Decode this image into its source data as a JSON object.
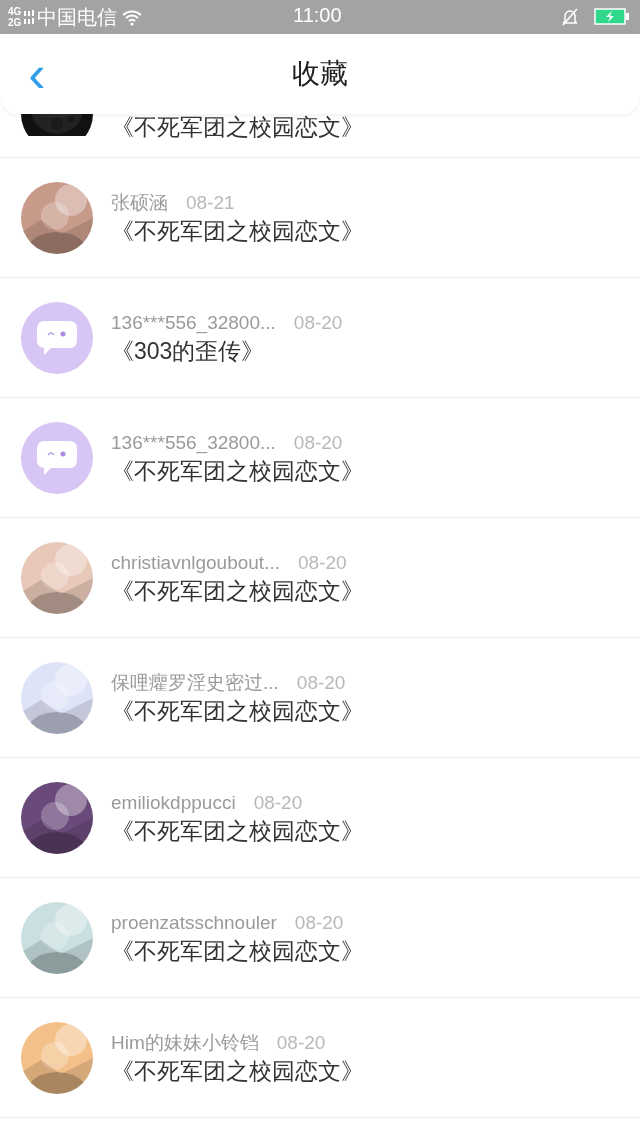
{
  "status_bar": {
    "network_top": "4G",
    "network_bottom": "2G",
    "carrier": "中国电信",
    "time": "11:00"
  },
  "header": {
    "back": "‹",
    "title": "收藏"
  },
  "items": [
    {
      "title": "《不死军团之校园恋文》"
    },
    {
      "name": "张硕涵",
      "date": "08-21",
      "title": "《不死军团之校园恋文》"
    },
    {
      "avatar": {
        "kind": "default",
        "color": "#d7c5f5"
      },
      "name": "136***556_32800...",
      "date": "08-20",
      "title": "《303的歪传》"
    },
    {
      "avatar": {
        "kind": "default",
        "color": "#d7c5f5"
      },
      "name": "136***556_32800...",
      "date": "08-20",
      "title": "《不死军团之校园恋文》"
    },
    {
      "name": "christiavnlgoubout...",
      "date": "08-20",
      "title": "《不死军团之校园恋文》"
    },
    {
      "name": "保哩癯罗淫史密过...",
      "date": "08-20",
      "title": "《不死军团之校园恋文》"
    },
    {
      "name": "emiliokdppucci",
      "date": "08-20",
      "title": "《不死军团之校园恋文》"
    },
    {
      "name": "proenzatsschnouler",
      "date": "08-20",
      "title": "《不死军团之校园恋文》"
    },
    {
      "name": "Him的妹妹小铃铛",
      "date": "08-20",
      "title": "《不死军团之校园恋文》"
    }
  ]
}
